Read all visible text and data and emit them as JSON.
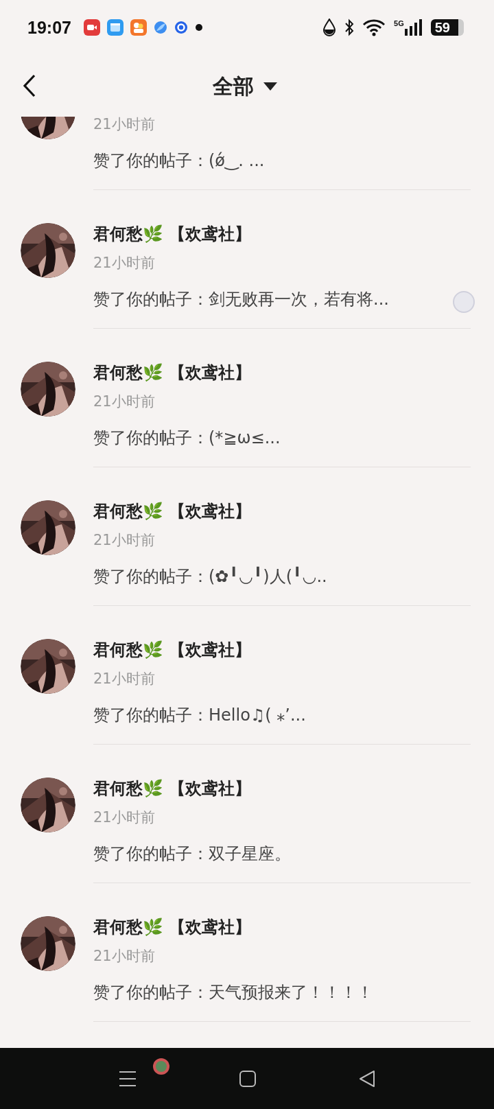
{
  "status_bar": {
    "time": "19:07",
    "network": "5G",
    "battery": "59"
  },
  "header": {
    "title": "全部"
  },
  "notifications": [
    {
      "time": "21小时前",
      "message": "赞了你的帖子：(ǿ‿. ..."
    },
    {
      "name": "君何愁🌿 【欢鸢社】",
      "time": "21小时前",
      "message": "赞了你的帖子：剑无败再一次，若有将..."
    },
    {
      "name": "君何愁🌿 【欢鸢社】",
      "time": "21小时前",
      "message": "赞了你的帖子：(*≧ω≤..."
    },
    {
      "name": "君何愁🌿 【欢鸢社】",
      "time": "21小时前",
      "message": "赞了你的帖子：(✿╹◡╹)人(╹◡.."
    },
    {
      "name": "君何愁🌿 【欢鸢社】",
      "time": "21小时前",
      "message": "赞了你的帖子：Hello♫( ⁎’..."
    },
    {
      "name": "君何愁🌿 【欢鸢社】",
      "time": "21小时前",
      "message": "赞了你的帖子：双子星座。"
    },
    {
      "name": "君何愁🌿 【欢鸢社】",
      "time": "21小时前",
      "message": "赞了你的帖子：天气预报来了！！！！"
    }
  ]
}
